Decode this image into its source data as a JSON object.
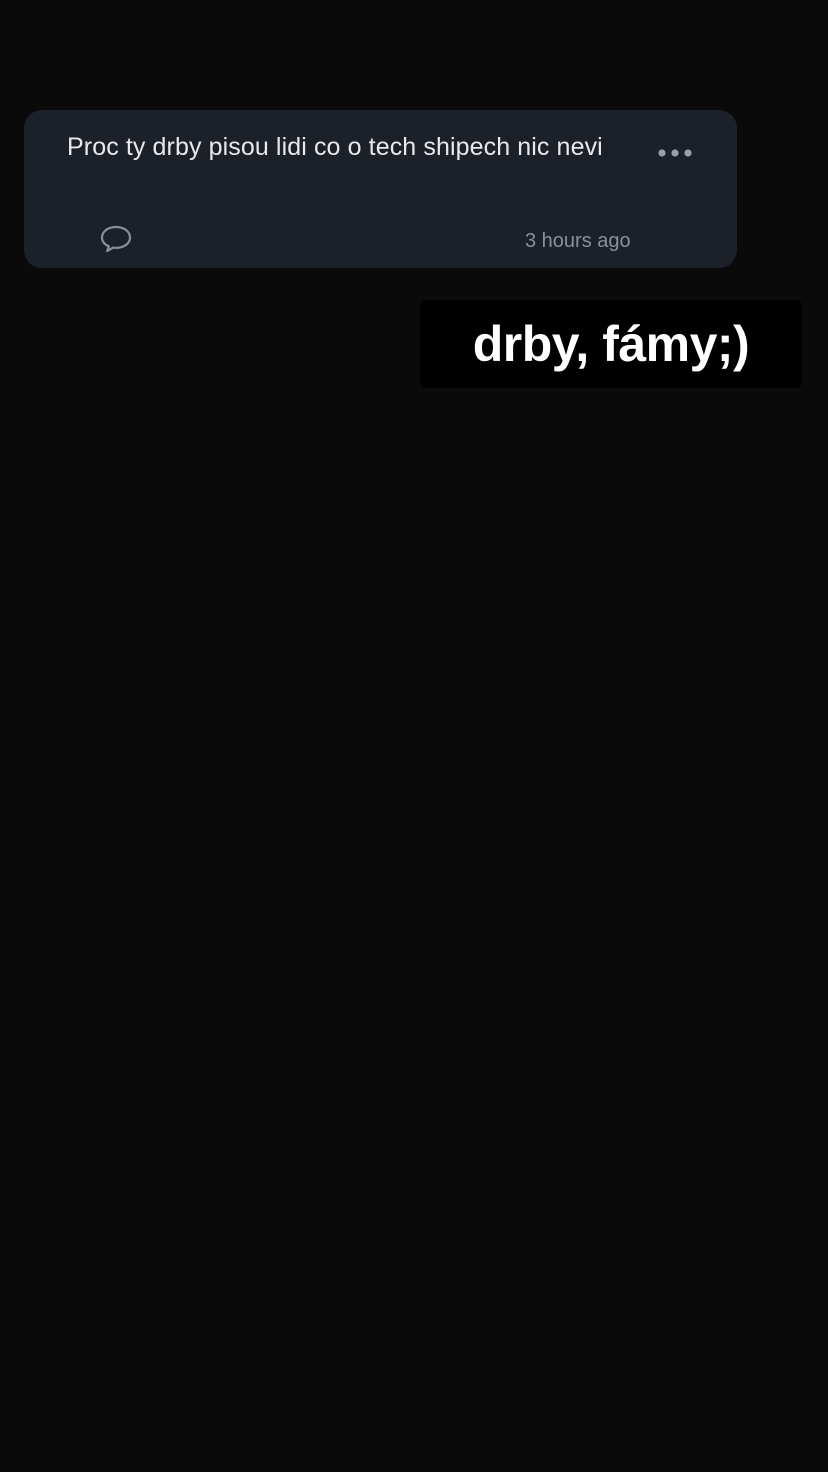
{
  "question_card": {
    "text": "Proc ty drby pisou lidi co o tech shipech nic nevi",
    "timestamp": "3 hours ago",
    "more_icon": "ellipsis-icon",
    "reply_icon": "speech-bubble-icon"
  },
  "sticker": {
    "text": "drby, fámy;)"
  },
  "colors": {
    "background": "#0a0a0b",
    "card": "#1c2129",
    "card_text": "#e7e9ec",
    "muted_text": "#8a8f98",
    "sticker_bg": "#000000",
    "sticker_text": "#ffffff"
  }
}
